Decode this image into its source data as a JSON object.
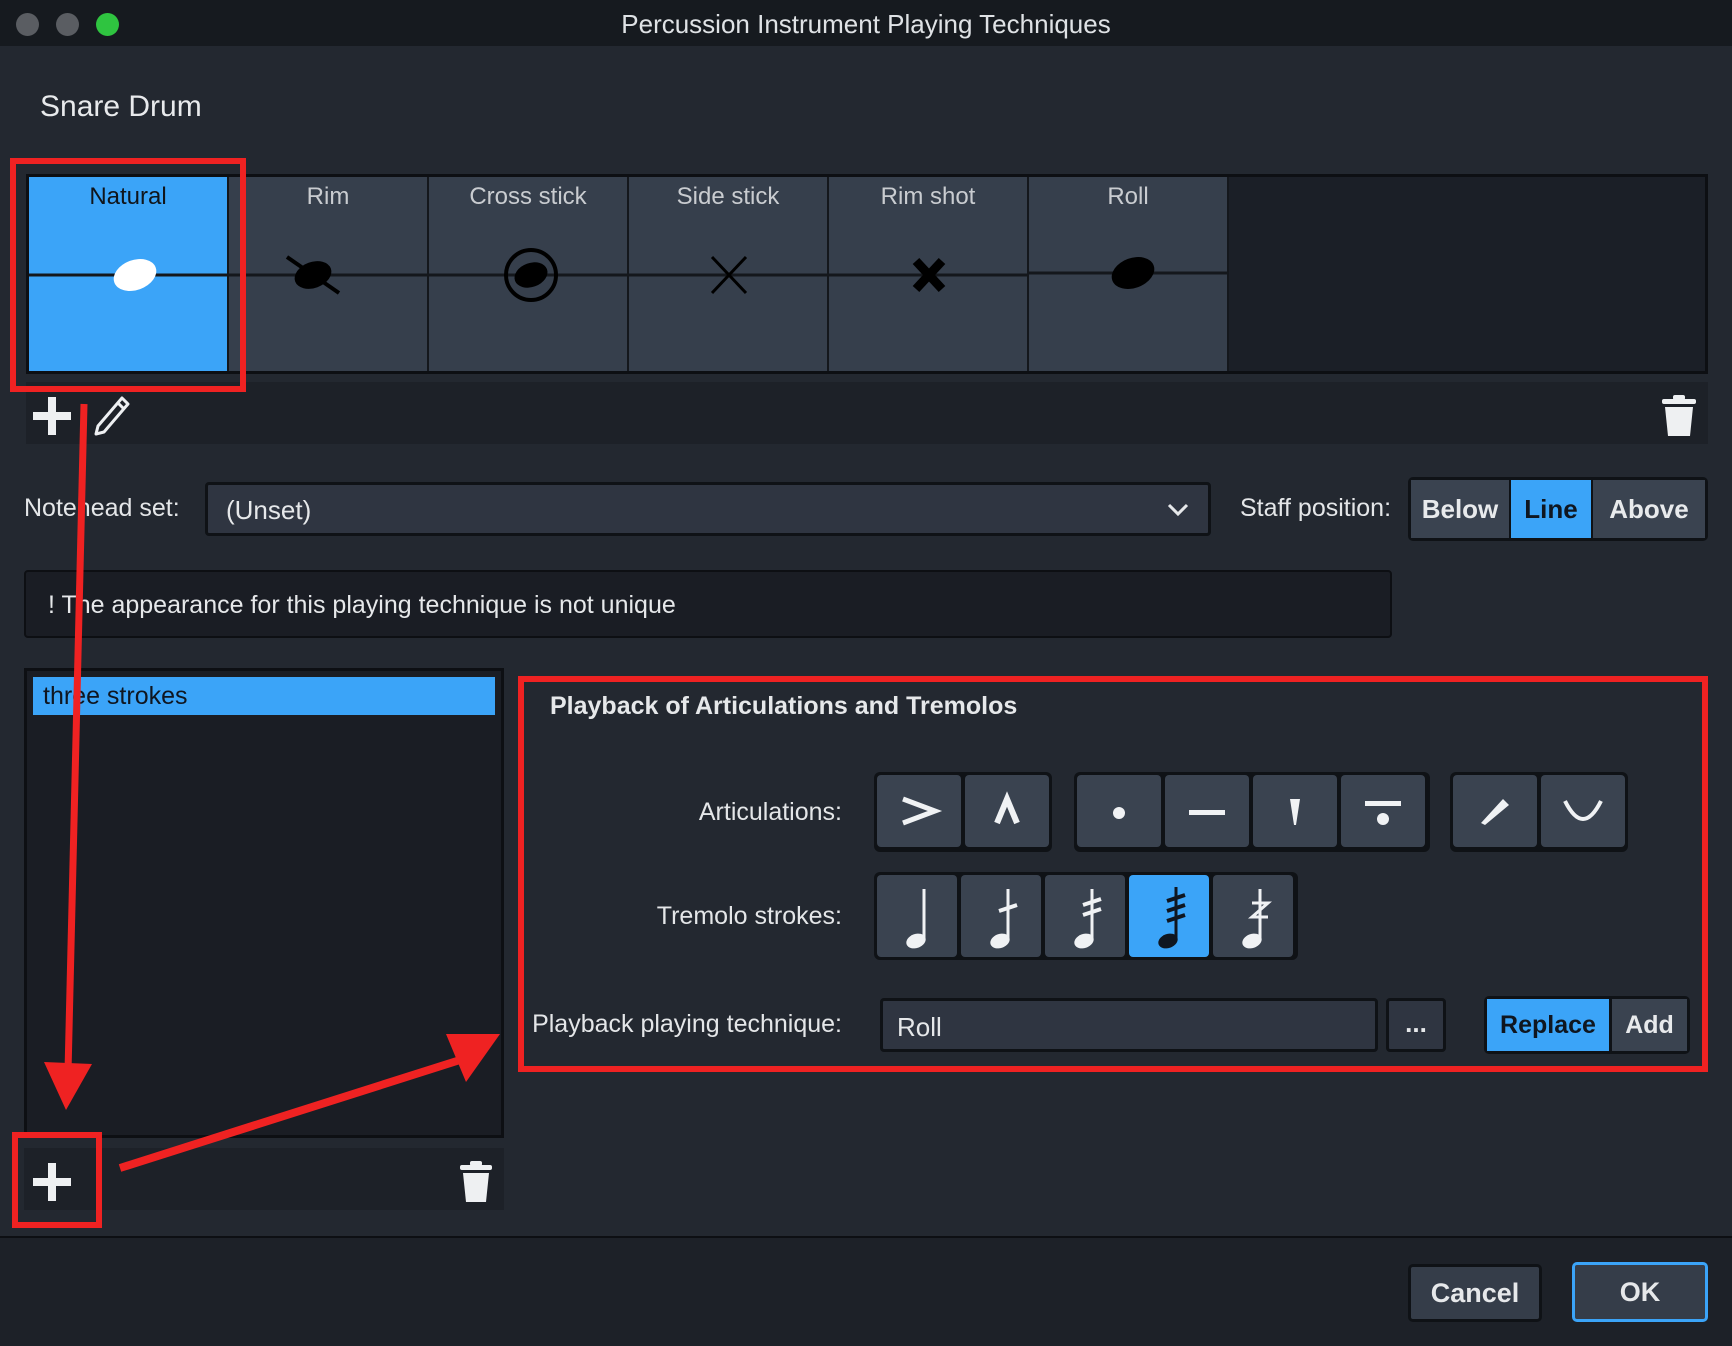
{
  "window": {
    "title": "Percussion Instrument Playing Techniques"
  },
  "instrument": {
    "name": "Snare Drum"
  },
  "techniques": [
    {
      "label": "Natural",
      "selected": true
    },
    {
      "label": "Rim",
      "selected": false
    },
    {
      "label": "Cross stick",
      "selected": false
    },
    {
      "label": "Side stick",
      "selected": false
    },
    {
      "label": "Rim shot",
      "selected": false
    },
    {
      "label": "Roll",
      "selected": false
    }
  ],
  "notehead": {
    "label": "Notehead set:",
    "value": "(Unset)"
  },
  "staff_position": {
    "label": "Staff position:",
    "options": [
      "Below",
      "Line",
      "Above"
    ],
    "selected": "Line"
  },
  "warning": {
    "text": "! The appearance for this playing technique is not unique"
  },
  "list": {
    "items": [
      "three strokes"
    ]
  },
  "playback": {
    "title": "Playback of Articulations and Tremolos",
    "articulations_label": "Articulations:",
    "articulations": [
      "accent-icon",
      "marcato-icon",
      "staccato-icon",
      "tenuto-icon",
      "staccatissimo-icon",
      "tenuto-staccato-icon",
      "stress-icon",
      "unstress-icon"
    ],
    "tremolo_label": "Tremolo strokes:",
    "tremolos": [
      "no-tremolo-icon",
      "one-stroke-icon",
      "two-strokes-icon",
      "three-strokes-icon",
      "buzz-roll-icon"
    ],
    "tremolo_selected_index": 3,
    "technique_label": "Playback playing technique:",
    "technique_value": "Roll",
    "dots_label": "...",
    "replace_label": "Replace",
    "add_label": "Add"
  },
  "footer": {
    "cancel_label": "Cancel",
    "ok_label": "OK"
  },
  "colors": {
    "accent": "#3ba4f8",
    "annotation": "#ef2222"
  }
}
